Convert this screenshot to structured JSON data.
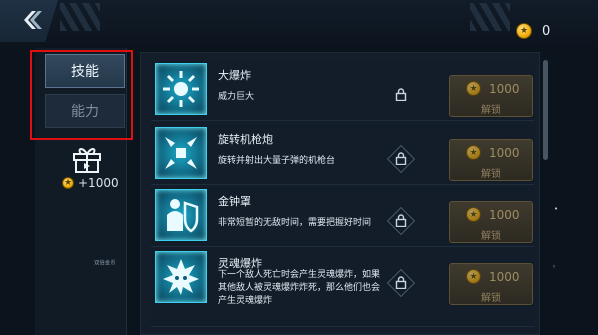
{
  "header": {
    "coin_count": "0"
  },
  "tabs": {
    "skill": "技能",
    "ability": "能力"
  },
  "reward": {
    "amount": "+1000"
  },
  "sidebar_small_label": "双倍金币",
  "skills": [
    {
      "name": "大爆炸",
      "desc": "威力巨大",
      "price": "1000",
      "action": "解锁"
    },
    {
      "name": "旋转机枪炮",
      "desc": "旋转并射出大量子弹的机枪台",
      "price": "1000",
      "action": "解锁"
    },
    {
      "name": "金钟罩",
      "desc": "非常短暂的无敌时间，需要把握好时间",
      "price": "1000",
      "action": "解锁"
    },
    {
      "name": "灵魂爆炸",
      "desc": "下一个敌人死亡时会产生灵魂爆炸，如果其他敌人被灵魂爆炸炸死，那么他们也会产生灵魂爆炸",
      "price": "1000",
      "action": "解锁"
    }
  ],
  "colors": {
    "accent_cyan": "#3bd1ee",
    "highlight_red": "#e01010",
    "coin_gold": "#f1b20f"
  }
}
